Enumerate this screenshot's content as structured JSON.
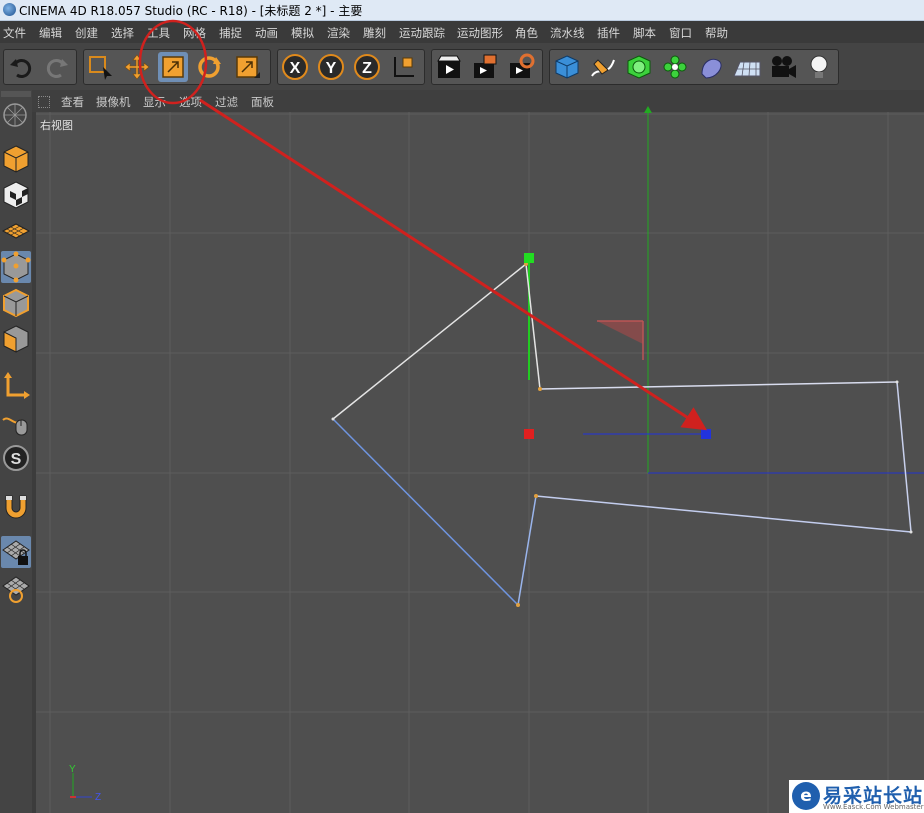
{
  "window": {
    "title": "CINEMA 4D R18.057 Studio (RC - R18) - [未标题 2 *] - 主要"
  },
  "menu": [
    "文件",
    "编辑",
    "创建",
    "选择",
    "工具",
    "网格",
    "捕捉",
    "动画",
    "模拟",
    "渲染",
    "雕刻",
    "运动跟踪",
    "运动图形",
    "角色",
    "流水线",
    "插件",
    "脚本",
    "窗口",
    "帮助"
  ],
  "toolbar": {
    "undo": "undo-icon",
    "redo": "redo-icon",
    "tools": [
      "live-selection-icon",
      "move-icon",
      "scale-icon",
      "rotate-icon",
      "recent-tool-icon"
    ],
    "active_tool": "scale-icon",
    "axis": [
      "X",
      "Y",
      "Z"
    ],
    "render": [
      "render-view-icon",
      "render-to-picture-viewer-icon",
      "render-settings-icon"
    ],
    "objects": [
      "cube-icon",
      "pen-icon",
      "subdivision-icon",
      "cloner-icon",
      "deformer-icon",
      "floor-icon",
      "camera-icon",
      "light-icon"
    ]
  },
  "viewport_menu": [
    "查看",
    "摄像机",
    "显示",
    "选项",
    "过滤",
    "面板"
  ],
  "viewport": {
    "name": "右视图"
  },
  "axis_gizmo": {
    "y": "Y",
    "z": "Z"
  },
  "annotation": {
    "color": "#d0211e"
  },
  "colors": {
    "viewport_bg": "#4f4f4f",
    "grid": "#5d5d5d",
    "spline_white": "#dcdcdc",
    "spline_blue": "#7fa6e6",
    "point": "#e0a040",
    "y_axis": "#22aa22",
    "z_axis": "#2233cc",
    "handle_red": "#e02020",
    "handle_green": "#22dd22",
    "handle_blue": "#2233dd",
    "active_btn": "#6f8fb6"
  },
  "watermark": {
    "text": "易采站长站",
    "sub": "Www.Easck.Com Webmaster"
  }
}
